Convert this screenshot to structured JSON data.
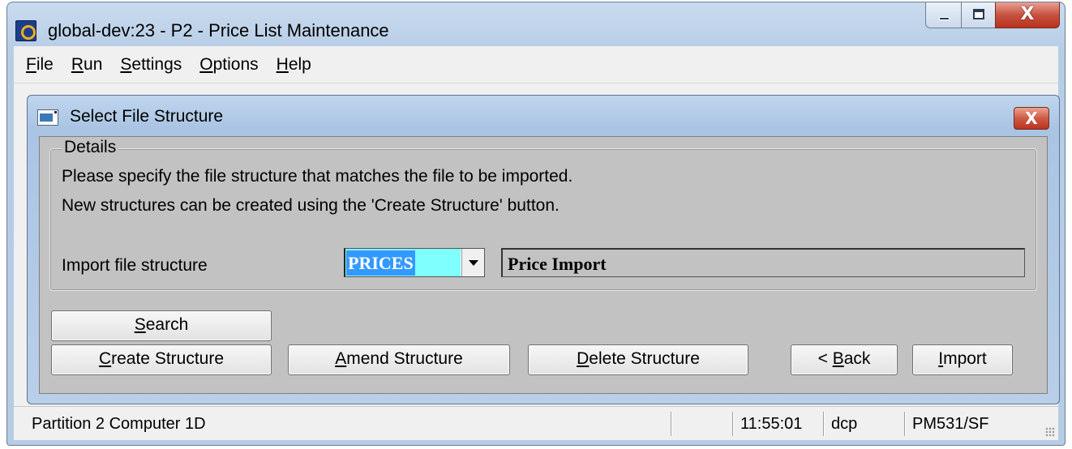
{
  "window": {
    "title": "global-dev:23 - P2 - Price List Maintenance",
    "close_glyph": "X"
  },
  "menu": [
    {
      "acc": "F",
      "rest": "ile"
    },
    {
      "acc": "R",
      "rest": "un"
    },
    {
      "acc": "S",
      "rest": "ettings"
    },
    {
      "acc": "O",
      "rest": "ptions"
    },
    {
      "acc": "H",
      "rest": "elp"
    }
  ],
  "dialog": {
    "title": "Select File Structure",
    "close_glyph": "X",
    "group_label": "Details",
    "info_line1": "Please specify the file structure that matches the file to be imported.",
    "info_line2": "New structures can be created using the 'Create Structure' button.",
    "field_label": "Import file structure",
    "structure_value": "PRICES",
    "structure_description": "Price Import"
  },
  "buttons": {
    "search": {
      "acc": "S",
      "rest": "earch"
    },
    "create": {
      "acc": "C",
      "rest": "reate Structure"
    },
    "amend": {
      "acc": "A",
      "rest": "mend Structure"
    },
    "delete": {
      "acc": "D",
      "rest": "elete Structure"
    },
    "back": {
      "pre": "< ",
      "acc": "B",
      "rest": "ack"
    },
    "import": {
      "acc": "I",
      "rest": "mport"
    }
  },
  "status": {
    "partition": "Partition 2 Computer 1D",
    "time": "11:55:01",
    "user": "dcp",
    "program": "PM531/SF"
  },
  "colors": {
    "selection_bg": "#3399ff",
    "field_bg": "#80ffff",
    "dialog_body": "#c2c2c2",
    "title_gradient": "#b7cde6"
  }
}
